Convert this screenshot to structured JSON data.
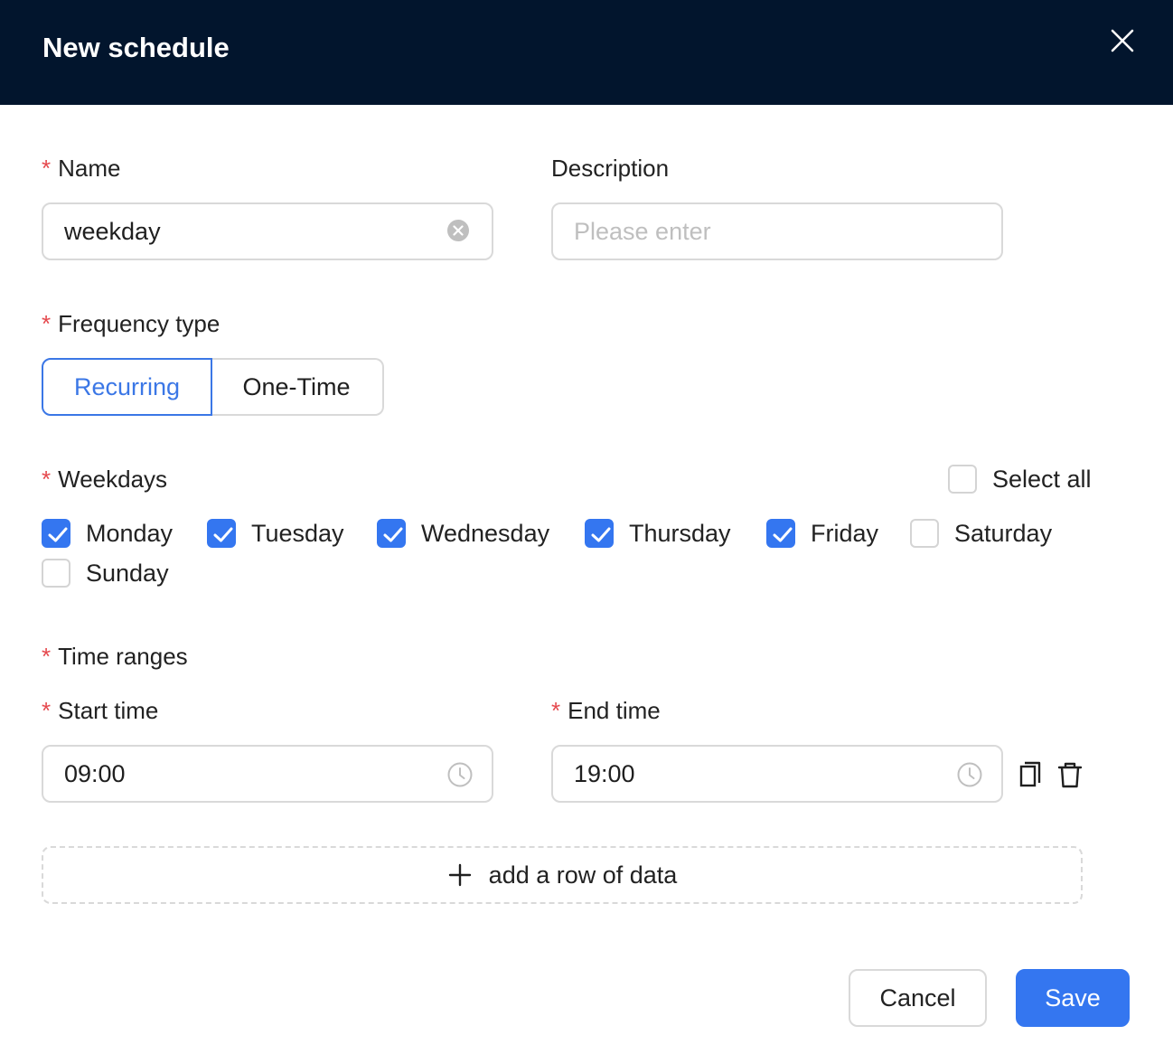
{
  "dialog": {
    "title": "New schedule",
    "close_icon": "close-icon"
  },
  "form": {
    "required_mark": "*",
    "name": {
      "label": "Name",
      "value": "weekday",
      "clear_icon": "clear-circle-icon"
    },
    "description": {
      "label": "Description",
      "value": "",
      "placeholder": "Please enter"
    },
    "frequency_type": {
      "label": "Frequency type",
      "options": [
        "Recurring",
        "One-Time"
      ],
      "selected": "Recurring"
    },
    "weekdays": {
      "label": "Weekdays",
      "select_all": {
        "label": "Select all",
        "checked": false
      },
      "days": [
        {
          "label": "Monday",
          "checked": true
        },
        {
          "label": "Tuesday",
          "checked": true
        },
        {
          "label": "Wednesday",
          "checked": true
        },
        {
          "label": "Thursday",
          "checked": true
        },
        {
          "label": "Friday",
          "checked": true
        },
        {
          "label": "Saturday",
          "checked": false
        },
        {
          "label": "Sunday",
          "checked": false
        }
      ]
    },
    "time_ranges": {
      "label": "Time ranges",
      "start_label": "Start time",
      "end_label": "End time",
      "rows": [
        {
          "start": "09:00",
          "end": "19:00"
        }
      ],
      "row_icons": [
        "clock-icon",
        "copy-icon",
        "delete-icon"
      ],
      "add_row_label": "add a row of data"
    }
  },
  "footer": {
    "cancel_label": "Cancel",
    "save_label": "Save"
  },
  "colors": {
    "header_bg": "#02152d",
    "primary": "#3476f0",
    "required": "#e5484d",
    "border": "#d9d9d9"
  }
}
